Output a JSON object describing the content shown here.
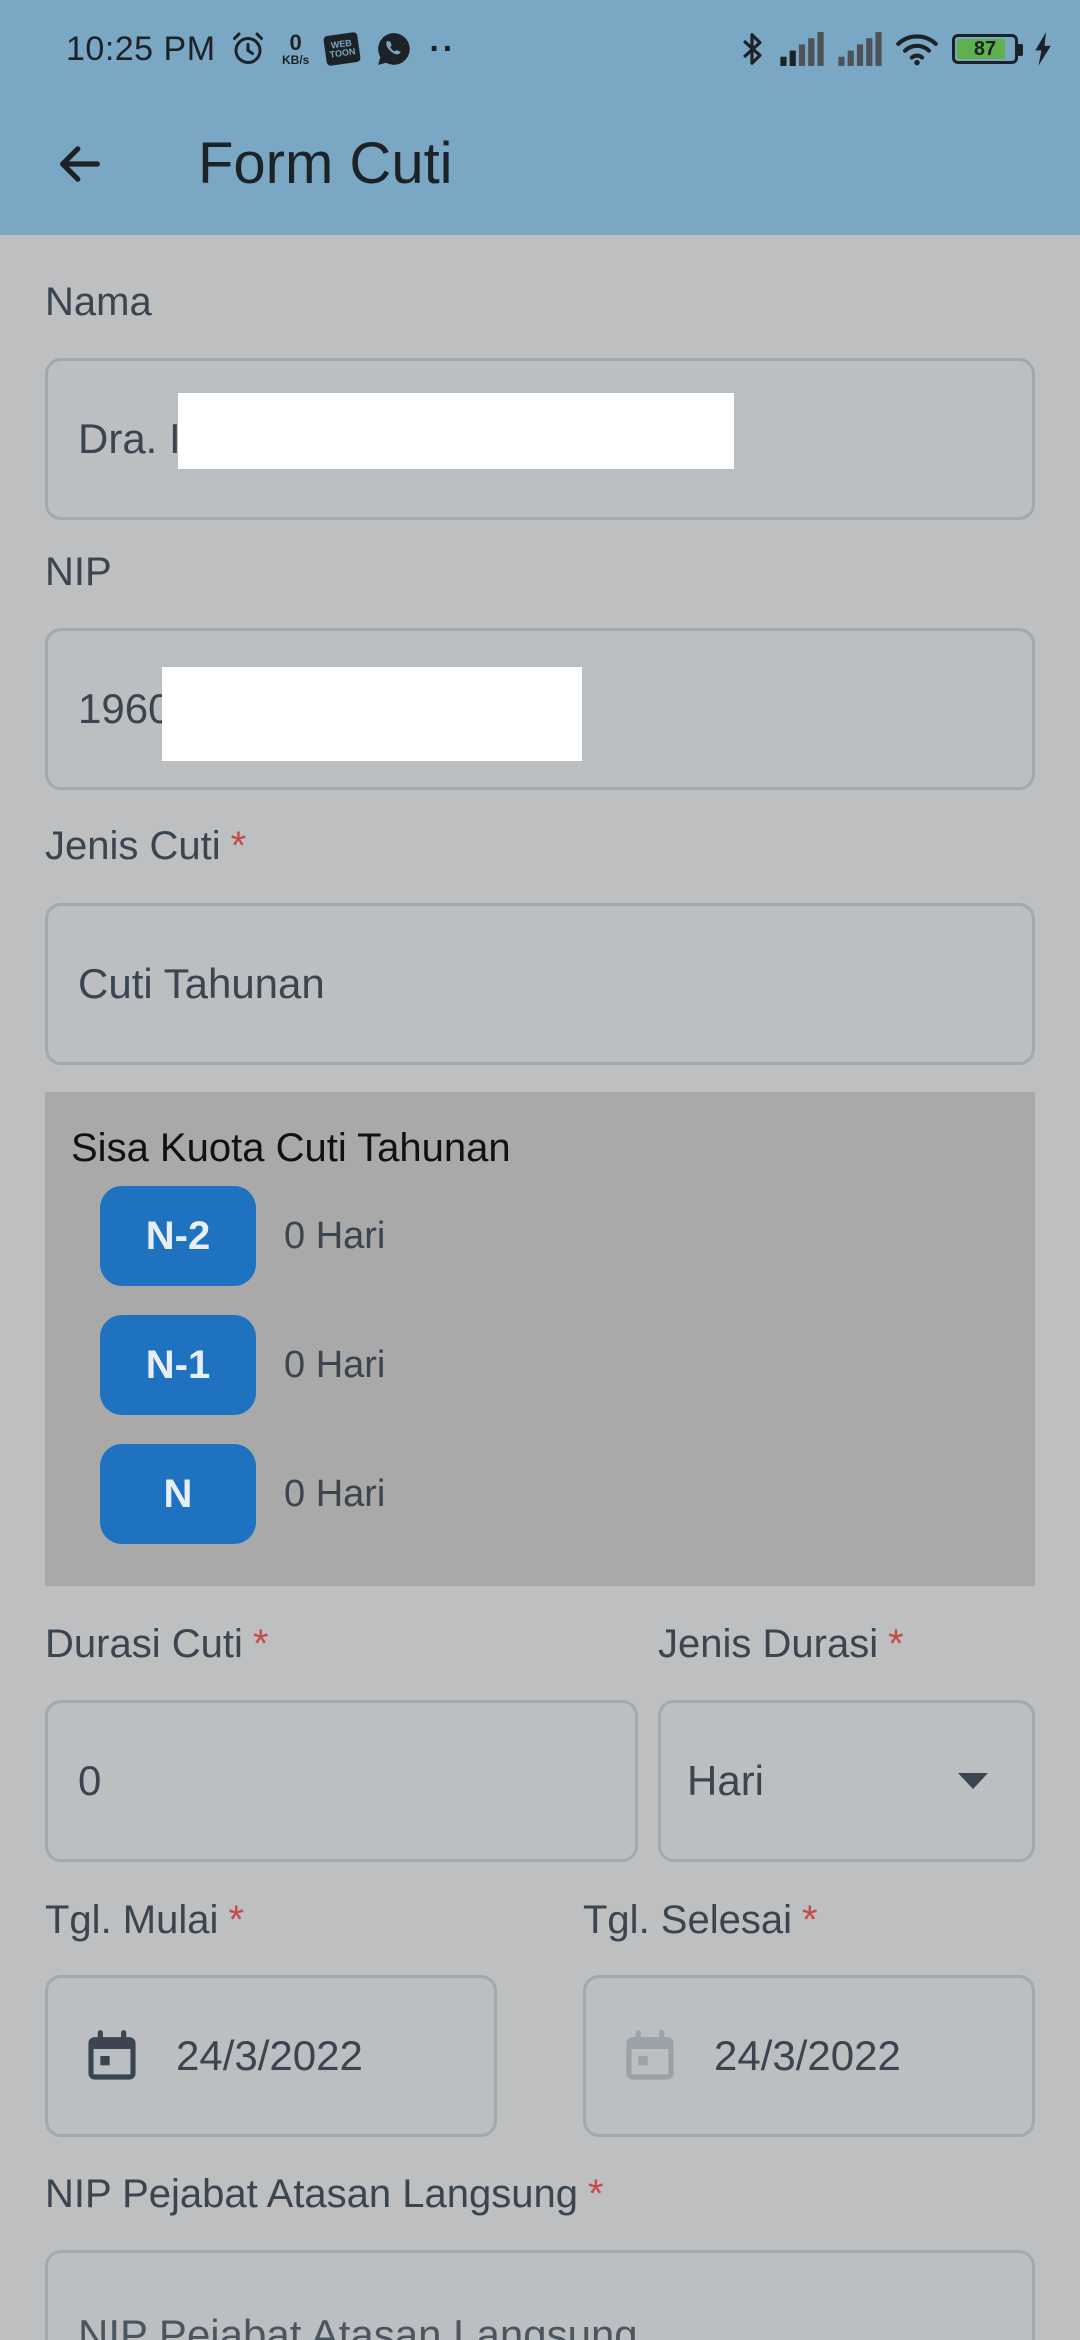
{
  "status_bar": {
    "time": "10:25 PM",
    "net_speed_value": "0",
    "net_speed_unit": "KB/s",
    "webtoon_label": "WEB TOON",
    "more_dots": "··",
    "battery_level": "87",
    "battery_percent": 87,
    "icons": [
      "alarm-icon",
      "webtoon-icon",
      "whatsapp-icon",
      "bluetooth-icon",
      "signal-icon",
      "signal-icon",
      "wifi-icon",
      "battery-icon",
      "charging-icon"
    ]
  },
  "toolbar": {
    "title": "Form Cuti"
  },
  "form": {
    "nama_label": "Nama",
    "nama_value": "Dra. I",
    "nip_label": "NIP",
    "nip_value": "1960",
    "jenis_cuti_label": "Jenis Cuti",
    "jenis_cuti_value": "Cuti Tahunan",
    "required_mark": "*",
    "quota": {
      "title": "Sisa Kuota Cuti Tahunan",
      "rows": [
        {
          "badge": "N-2",
          "value": "0 Hari"
        },
        {
          "badge": "N-1",
          "value": "0 Hari"
        },
        {
          "badge": "N",
          "value": "0 Hari"
        }
      ]
    },
    "durasi_label": "Durasi Cuti",
    "durasi_value": "0",
    "jenis_durasi_label": "Jenis Durasi",
    "jenis_durasi_value": "Hari",
    "tgl_mulai_label": "Tgl. Mulai",
    "tgl_mulai_value": "24/3/2022",
    "tgl_selesai_label": "Tgl. Selesai",
    "tgl_selesai_value": "24/3/2022",
    "nip_atasan_label": "NIP Pejabat Atasan Langsung",
    "nip_atasan_placeholder": "NIP Pejabat Atasan Langsung"
  },
  "colors": {
    "appbar": "#7aa7c3",
    "background": "#bdbfc1",
    "quota_badge": "#1e72c0",
    "required": "#c54b4b"
  }
}
